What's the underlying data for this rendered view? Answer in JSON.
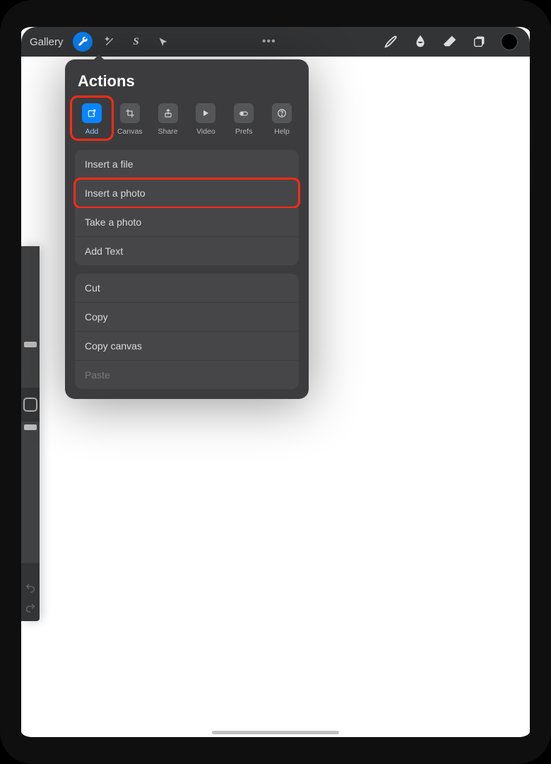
{
  "toolbar": {
    "gallery_label": "Gallery"
  },
  "popover": {
    "title": "Actions",
    "tabs": {
      "add": "Add",
      "canvas": "Canvas",
      "share": "Share",
      "video": "Video",
      "prefs": "Prefs",
      "help": "Help"
    },
    "group1": {
      "insert_file": "Insert a file",
      "insert_photo": "Insert a photo",
      "take_photo": "Take a photo",
      "add_text": "Add Text"
    },
    "group2": {
      "cut": "Cut",
      "copy": "Copy",
      "copy_canvas": "Copy canvas",
      "paste": "Paste"
    }
  }
}
